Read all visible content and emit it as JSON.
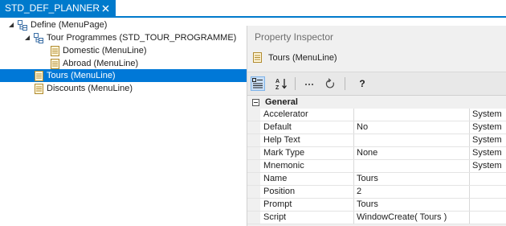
{
  "tab": {
    "title": "STD_DEF_PLANNER"
  },
  "tree": {
    "items": [
      {
        "label": "Define (MenuPage)"
      },
      {
        "label": "Tour Programmes (STD_TOUR_PROGRAMME)"
      },
      {
        "label": "Domestic (MenuLine)"
      },
      {
        "label": "Abroad (MenuLine)"
      },
      {
        "label": "Tours (MenuLine)"
      },
      {
        "label": "Discounts (MenuLine)"
      }
    ]
  },
  "inspector": {
    "title": "Property Inspector",
    "object_label": "Tours (MenuLine)",
    "toolbar": {
      "help_label": "?"
    },
    "category": "General",
    "properties": [
      {
        "name": "Accelerator",
        "value": "",
        "source": "System"
      },
      {
        "name": "Default",
        "value": "No",
        "source": "System"
      },
      {
        "name": "Help Text",
        "value": "",
        "source": "System"
      },
      {
        "name": "Mark Type",
        "value": "None",
        "source": "System"
      },
      {
        "name": "Mnemonic",
        "value": "",
        "source": "System"
      },
      {
        "name": "Name",
        "value": "Tours",
        "source": ""
      },
      {
        "name": "Position",
        "value": "2",
        "source": ""
      },
      {
        "name": "Prompt",
        "value": "Tours",
        "source": ""
      },
      {
        "name": "Script",
        "value": "WindowCreate( Tours )",
        "source": ""
      }
    ]
  },
  "colors": {
    "accent": "#007acc",
    "selection": "#0078d7"
  }
}
